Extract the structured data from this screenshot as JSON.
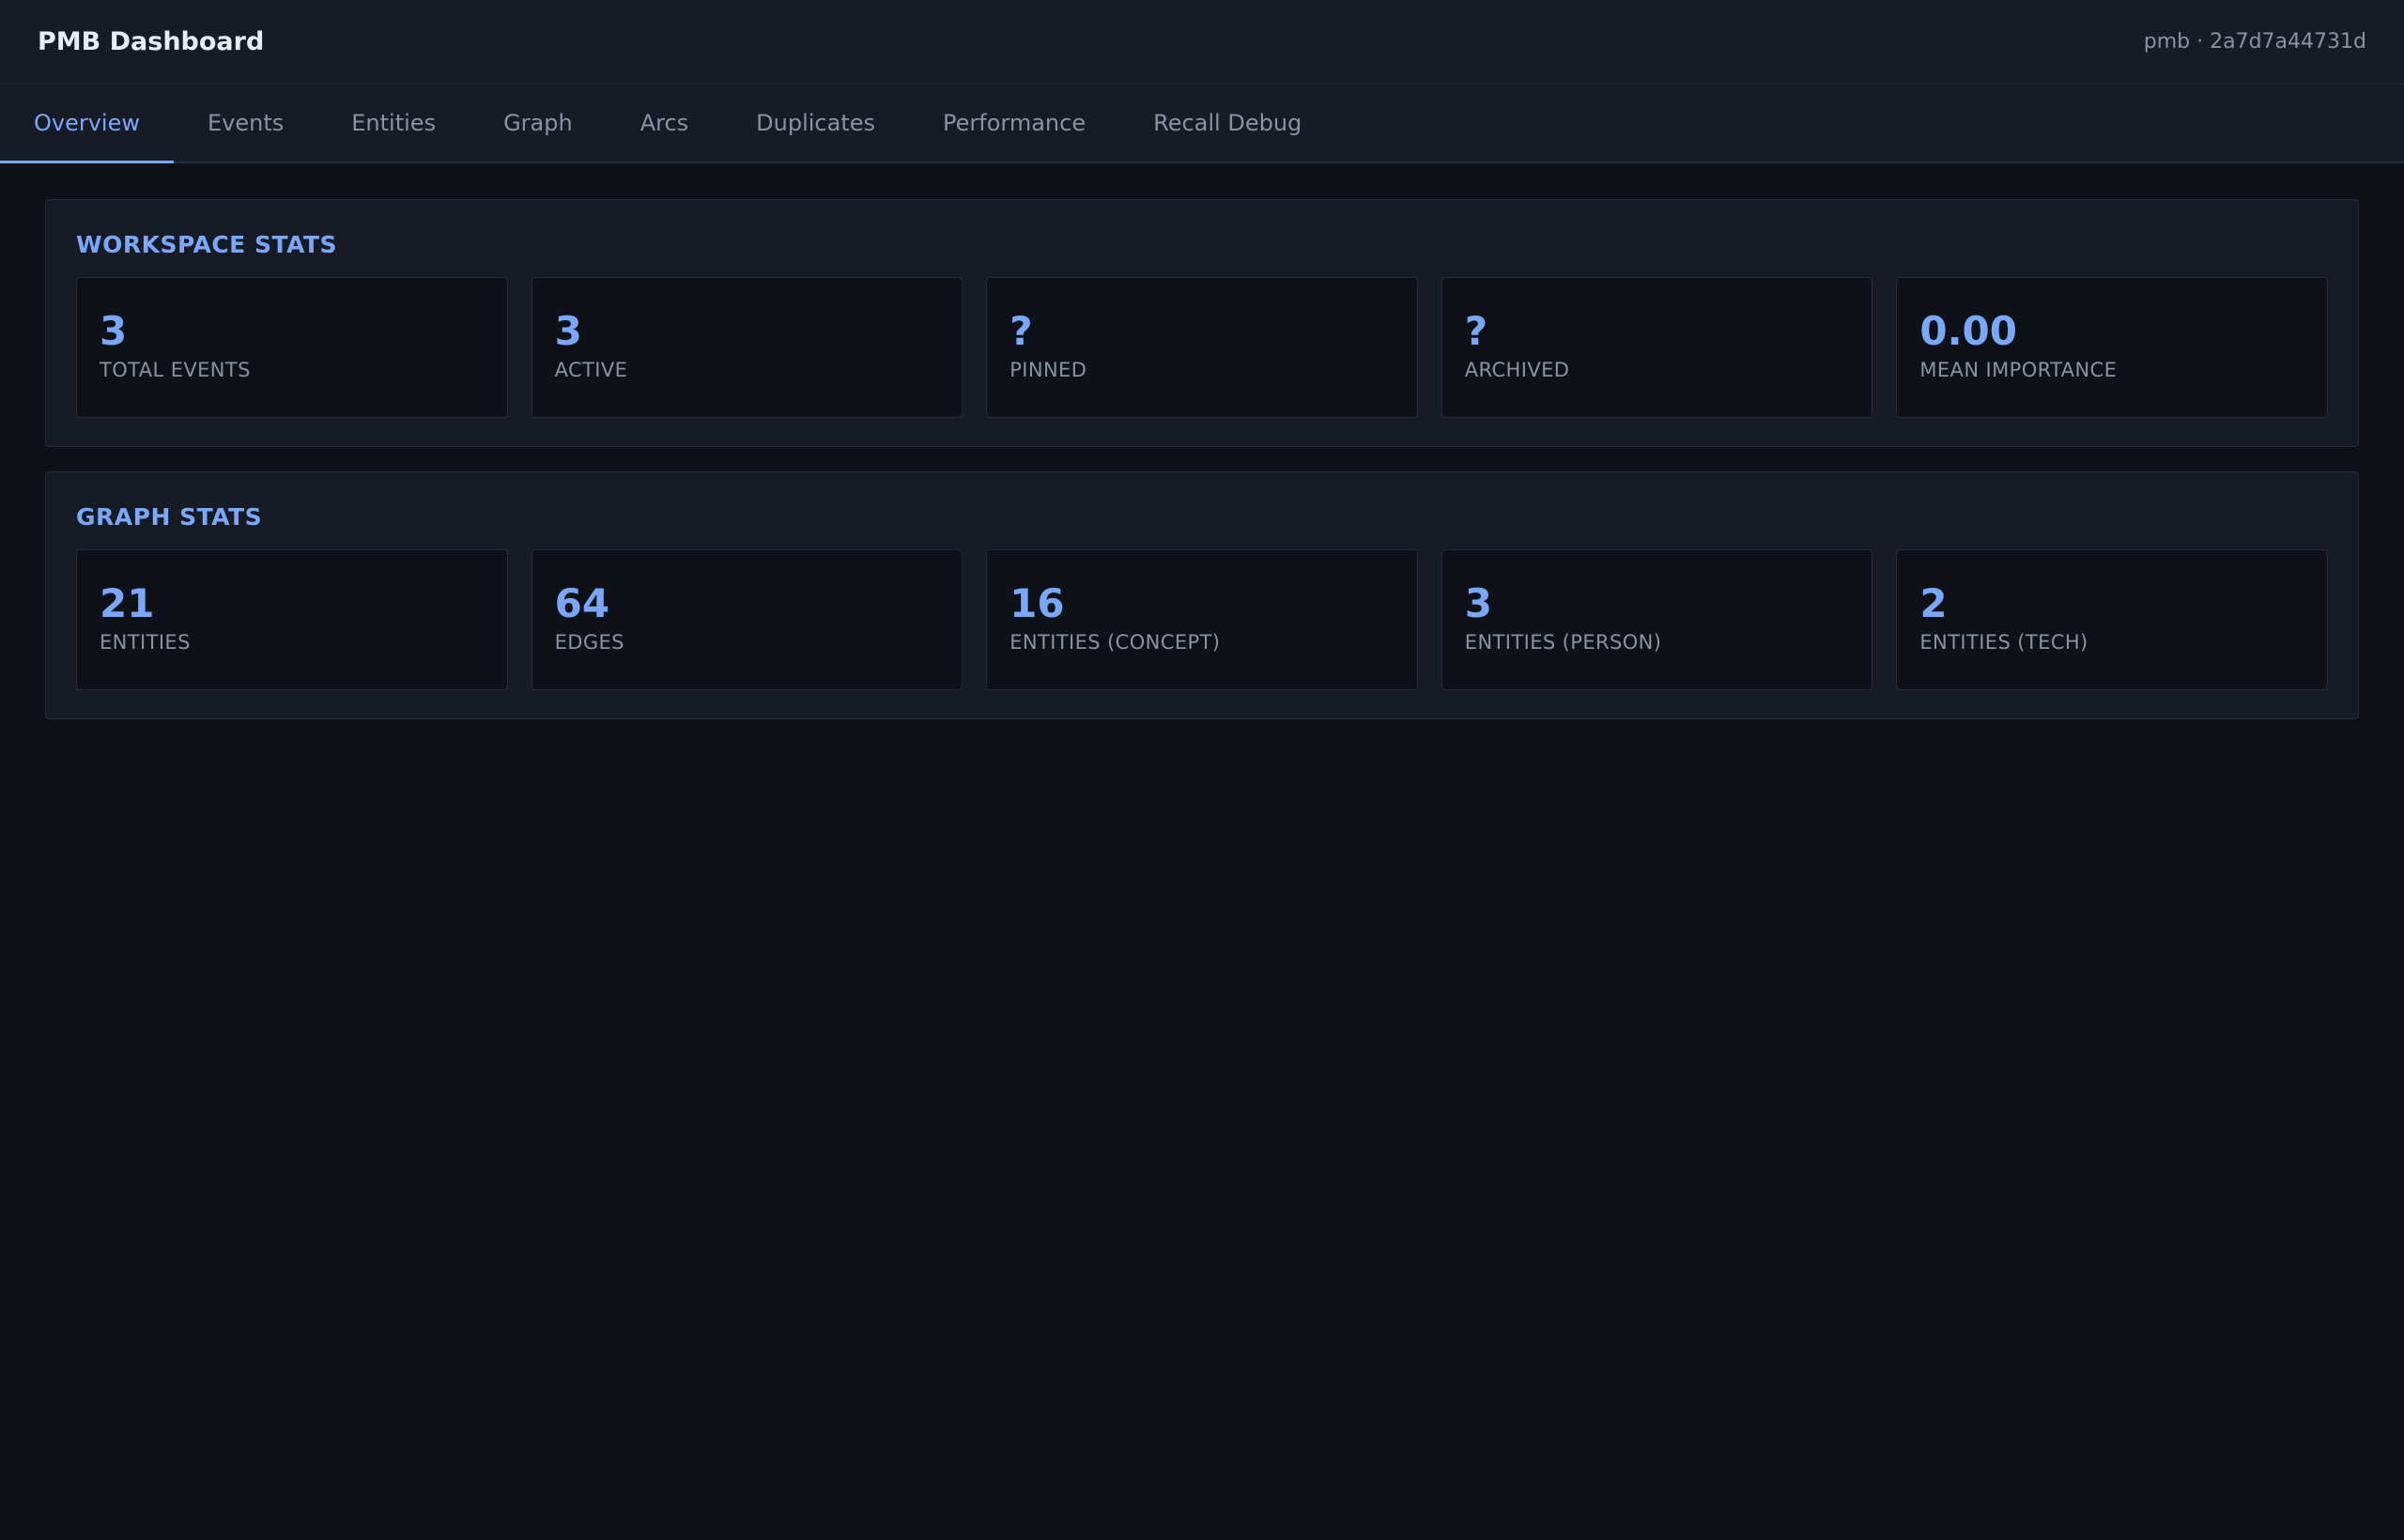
{
  "header": {
    "title": "PMB Dashboard",
    "workspace": "pmb · 2a7d7a44731d"
  },
  "tabs": [
    {
      "label": "Overview",
      "active": true
    },
    {
      "label": "Events",
      "active": false
    },
    {
      "label": "Entities",
      "active": false
    },
    {
      "label": "Graph",
      "active": false
    },
    {
      "label": "Arcs",
      "active": false
    },
    {
      "label": "Duplicates",
      "active": false
    },
    {
      "label": "Performance",
      "active": false
    },
    {
      "label": "Recall Debug",
      "active": false
    }
  ],
  "workspace_stats": {
    "title": "WORKSPACE STATS",
    "cards": [
      {
        "value": "3",
        "label": "TOTAL EVENTS"
      },
      {
        "value": "3",
        "label": "ACTIVE"
      },
      {
        "value": "?",
        "label": "PINNED"
      },
      {
        "value": "?",
        "label": "ARCHIVED"
      },
      {
        "value": "0.00",
        "label": "MEAN IMPORTANCE"
      }
    ]
  },
  "graph_stats": {
    "title": "GRAPH STATS",
    "cards": [
      {
        "value": "21",
        "label": "ENTITIES"
      },
      {
        "value": "64",
        "label": "EDGES"
      },
      {
        "value": "16",
        "label": "ENTITIES (CONCEPT)"
      },
      {
        "value": "3",
        "label": "ENTITIES (PERSON)"
      },
      {
        "value": "2",
        "label": "ENTITIES (TECH)"
      }
    ]
  },
  "colors": {
    "accent": "#7aa7f7",
    "background": "#0d1017",
    "panel": "#161b26",
    "muted_text": "#8b93a1"
  }
}
